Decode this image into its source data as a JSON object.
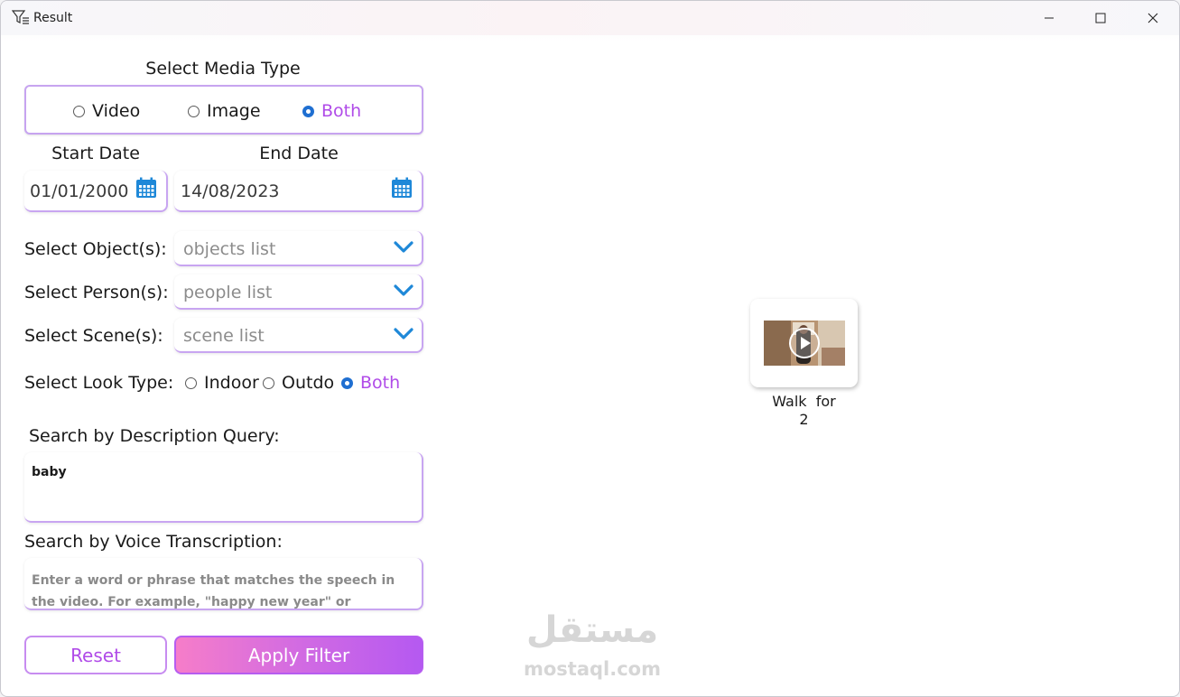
{
  "window": {
    "title": "Result"
  },
  "media_type": {
    "heading": "Select Media Type",
    "options": [
      {
        "label": "Video",
        "checked": false
      },
      {
        "label": "Image",
        "checked": false
      },
      {
        "label": "Both",
        "checked": true
      }
    ]
  },
  "dates": {
    "start_label": "Start Date",
    "start_value": "01/01/2000",
    "end_label": "End Date",
    "end_value": "14/08/2023"
  },
  "filters": {
    "objects_label": "Select Object(s):",
    "objects_placeholder": "objects list",
    "persons_label": "Select Person(s):",
    "persons_placeholder": "people list",
    "scenes_label": "Select Scene(s):",
    "scenes_placeholder": "scene list"
  },
  "look_type": {
    "label": "Select Look Type:",
    "options": [
      {
        "label": "Indoor",
        "checked": false
      },
      {
        "label": "Outdoor",
        "checked": false
      },
      {
        "label": "Both",
        "checked": true
      }
    ]
  },
  "description": {
    "label": "Search by Description Query:",
    "value": "baby"
  },
  "voice": {
    "label": "Search by Voice Transcription:",
    "placeholder": "Enter a word or phrase that matches the speech in the video. For example, \"happy new year\" or \"welcome home\"."
  },
  "buttons": {
    "reset": "Reset",
    "apply": "Apply Filter"
  },
  "results": [
    {
      "caption_line1": "Walk  for",
      "caption_line2": "2"
    }
  ],
  "watermark": {
    "arabic": "مستقل",
    "latin": "mostaql.com"
  },
  "colors": {
    "accent": "#b04be8",
    "radio_checked": "#1f6fd1",
    "calendar_blue": "#1e88d8"
  }
}
